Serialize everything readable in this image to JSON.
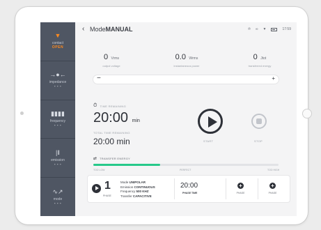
{
  "header": {
    "title_prefix": "Mode",
    "title_mode": "MANUAL",
    "status_time": "17:59"
  },
  "sidebar": {
    "items": [
      {
        "label": "contact",
        "value": "OPEN"
      },
      {
        "label": "impedance",
        "value": "- - -"
      },
      {
        "label": "frequency",
        "value": "- - -"
      },
      {
        "label": "emission",
        "value": "- - -"
      },
      {
        "label": "mode",
        "value": "- - -"
      }
    ]
  },
  "readouts": {
    "output_voltage": {
      "value": "0",
      "unit": "Vrms",
      "caption": "output voltage"
    },
    "instantaneous_power": {
      "value": "0.0",
      "unit": "Wrms",
      "caption": "instantaneous power"
    },
    "transferred_energy": {
      "value": "0",
      "unit": "Jtot",
      "caption": "transferred energy"
    }
  },
  "slider": {
    "minus": "−",
    "plus": "+"
  },
  "timer": {
    "label": "TIME REMAINING",
    "value": "20:00",
    "unit": "min",
    "total_label": "TOTAL TIME REMAINING",
    "total_value": "20:00 min"
  },
  "controls": {
    "start_label": "START",
    "stop_label": "STOP"
  },
  "energy": {
    "label": "TRANSFER ENERGY",
    "level": 0.36,
    "scale_low": "TOO LOW",
    "scale_mid": "PERFECT",
    "scale_high": "TOO HIGH"
  },
  "phase": {
    "number": "1",
    "label": "PHASE",
    "mode_label": "Mode",
    "mode_value": "UNIPOLAR",
    "emission_label": "Emission",
    "emission_value": "CONTINUOUS",
    "frequency_label": "Frequency",
    "frequency_value": "500 KHZ",
    "transfer_label": "Transfer",
    "transfer_value": "CAPACITIVE",
    "time_value": "20:00",
    "time_label": "PHASE TIME",
    "add1_label": "PHASE",
    "add2_label": "PHASE"
  },
  "colors": {
    "accent": "#ff8a1d",
    "sidebar": "#4f5663",
    "energy": "#27c98a"
  }
}
